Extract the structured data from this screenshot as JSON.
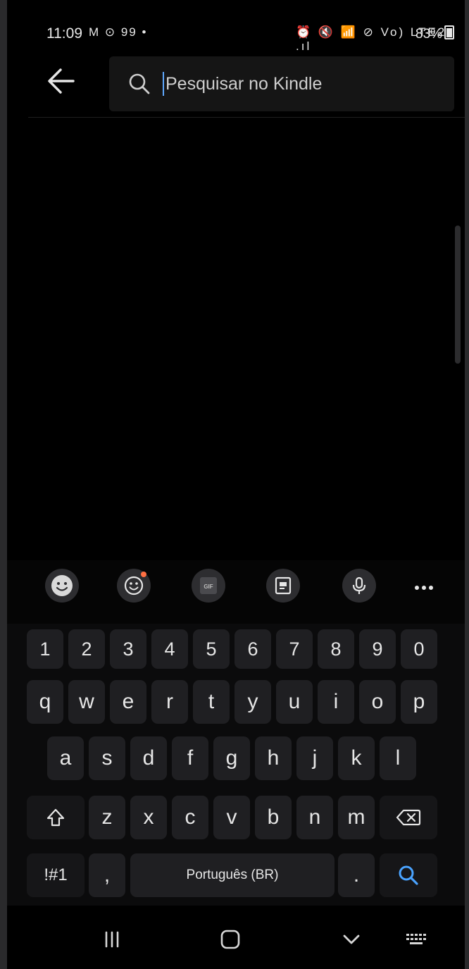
{
  "status_bar": {
    "time": "11:09",
    "left_icons": "M ⊙ 99 •",
    "right_icons": "⏰ 🔇 📶 ⊘ Vo) LTE2 .ıl",
    "battery": "83%"
  },
  "search": {
    "placeholder": "Pesquisar no Kindle",
    "value": ""
  },
  "keyboard_toolbar": {
    "items": [
      "emoji-face",
      "sticker",
      "gif",
      "clipboard",
      "voice-input",
      "more"
    ],
    "accent": "#ff7043"
  },
  "keyboard": {
    "number_row": [
      "1",
      "2",
      "3",
      "4",
      "5",
      "6",
      "7",
      "8",
      "9",
      "0"
    ],
    "row1": [
      "q",
      "w",
      "e",
      "r",
      "t",
      "y",
      "u",
      "i",
      "o",
      "p"
    ],
    "row2": [
      "a",
      "s",
      "d",
      "f",
      "g",
      "h",
      "j",
      "k",
      "l"
    ],
    "row3": [
      "z",
      "x",
      "c",
      "v",
      "b",
      "n",
      "m"
    ],
    "symbols": "!#1",
    "comma": ",",
    "space": "Português (BR)",
    "period": ".",
    "search_color": "#4aa3ff"
  },
  "nav_bar": {
    "items": [
      "recent-apps",
      "home",
      "hide-keyboard",
      "keyboard-switch"
    ]
  }
}
